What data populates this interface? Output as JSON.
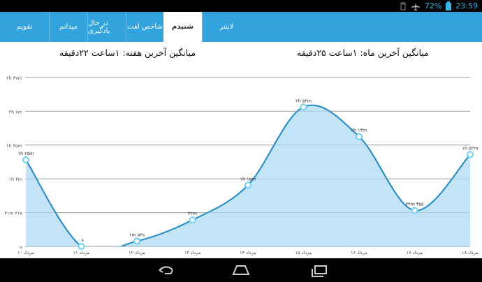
{
  "status": {
    "battery": "72%",
    "time": "23:59"
  },
  "tabs": [
    {
      "label": "تقویم"
    },
    {
      "label": "میدانم"
    },
    {
      "label": "در حال یادگیری"
    },
    {
      "label": "شاخص لغت"
    },
    {
      "label": "شنیدم"
    },
    {
      "label": "لایتنر"
    }
  ],
  "headings": {
    "week": "میانگین آخرین هفته: ۱ساعت ۲۲دقیقه",
    "month": "میانگین آخرین ماه: ۱ساعت ۲۵دقیقه"
  },
  "chart_data": {
    "type": "area",
    "title": "",
    "xlabel": "",
    "ylabel": "",
    "y_unit": "minutes",
    "ylim": [
      0,
      160
    ],
    "y_ticks": [
      {
        "value": 0,
        "label": "۰s"
      },
      {
        "value": 32,
        "label": "۳۱m ۴۶s"
      },
      {
        "value": 64,
        "label": "۱h ۳m"
      },
      {
        "value": 96,
        "label": "۱h ۳۵m"
      },
      {
        "value": 128,
        "label": "۲h ۶m"
      },
      {
        "value": 160,
        "label": "۲h ۳۷m"
      }
    ],
    "categories": [
      "۱۰ مرداد",
      "۱۱ مرداد",
      "۱۲ مرداد",
      "۱۳ مرداد",
      "۱۴ مرداد",
      "۱۵ مرداد",
      "۱۶ مرداد",
      "۱۷ مرداد",
      "۱۸ مرداد"
    ],
    "values": [
      82,
      0,
      5,
      25,
      58,
      132,
      104,
      34,
      87
    ],
    "point_labels": [
      "۱h ۲۵m",
      "۰s",
      "۶m ۵۴s",
      "۳۲m",
      "۱h ۱۵m",
      "۲h ۵۲m",
      "۲h ۱۳m",
      "۴۴m ۳۵s",
      "۱h ۵۲m"
    ],
    "grid": true,
    "fill_color": "#b7dff4",
    "line_color": "#1e88c8",
    "point_color": "#6ed0f2"
  },
  "nav": {
    "back": "back-icon",
    "home": "home-icon",
    "recents": "recents-icon"
  }
}
